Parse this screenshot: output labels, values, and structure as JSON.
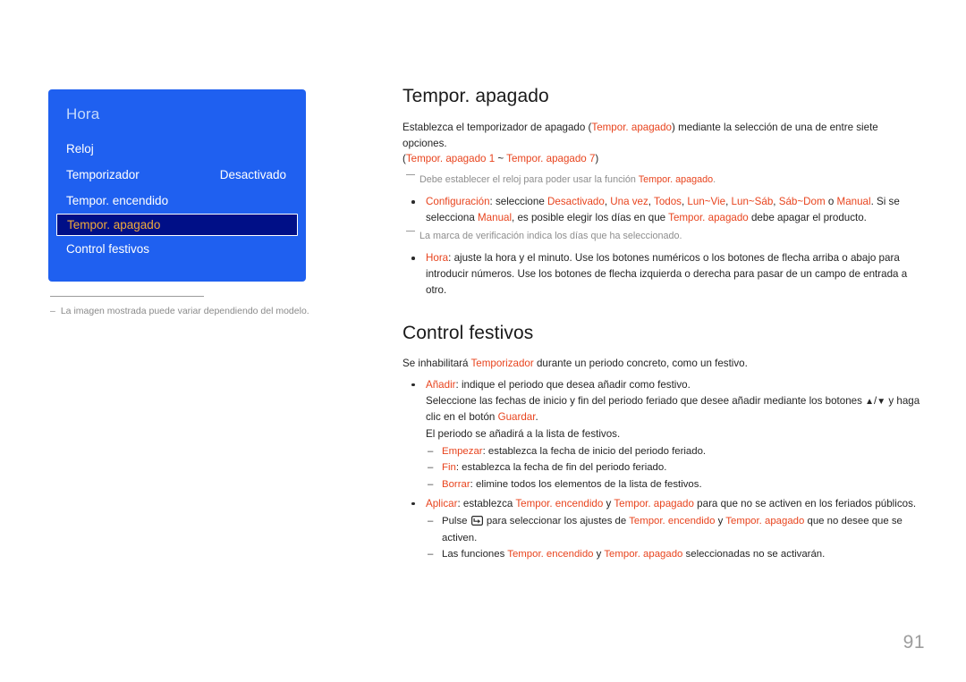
{
  "osd": {
    "title": "Hora",
    "rows": [
      {
        "label": "Reloj",
        "value": "",
        "selected": false
      },
      {
        "label": "Temporizador",
        "value": "Desactivado",
        "selected": false
      },
      {
        "label": "Tempor. encendido",
        "value": "",
        "selected": false
      },
      {
        "label": "Tempor. apagado",
        "value": "",
        "selected": true
      },
      {
        "label": "Control festivos",
        "value": "",
        "selected": false
      }
    ],
    "caption_dash": "–",
    "caption": "La imagen mostrada puede variar dependiendo del modelo."
  },
  "doc": {
    "heading1": "Tempor. apagado",
    "intro_1": "Establezca el temporizador de apagado (",
    "intro_accent_1": "Tempor. apagado",
    "intro_2": ") mediante la selección de una de entre siete opciones.",
    "intro_3": "(",
    "intro_accent_2": "Tempor. apagado 1",
    "intro_4": " ~ ",
    "intro_accent_3": "Tempor. apagado 7",
    "intro_5": ")",
    "note1_mark": "⎺",
    "note1_a": "Debe establecer el reloj para poder usar la función ",
    "note1_accent": "Tempor. apagado",
    "note1_b": ".",
    "b1_accent": "Configuración",
    "b1_t1": ": seleccione ",
    "b1_o1": "Desactivado",
    "b1_t2": ", ",
    "b1_o2": "Una vez",
    "b1_t3": ", ",
    "b1_o3": "Todos",
    "b1_t4": ", ",
    "b1_o4": "Lun~Vie",
    "b1_t5": ", ",
    "b1_o5": "Lun~Sáb",
    "b1_t6": ", ",
    "b1_o6": "Sáb~Dom",
    "b1_t7": " o ",
    "b1_o7": "Manual",
    "b1_t8": ". Si se selecciona ",
    "b1_o8": "Manual",
    "b1_t9": ", es posible elegir los días en que ",
    "b1_o9": "Tempor. apagado",
    "b1_t10": " debe apagar el producto.",
    "note2_mark": "⎺",
    "note2": "La marca de verificación indica los días que ha seleccionado.",
    "b2_accent": "Hora",
    "b2_text": ": ajuste la hora y el minuto. Use los botones numéricos o los botones de flecha arriba o abajo para introducir números. Use los botones de flecha izquierda o derecha para pasar de un campo de entrada a otro.",
    "heading2": "Control festivos",
    "intro2_1": "Se inhabilitará ",
    "intro2_accent": "Temporizador",
    "intro2_2": " durante un periodo concreto, como un festivo.",
    "b3_accent": "Añadir",
    "b3_text": ": indique el periodo que desea añadir como festivo.",
    "b3_sub1_a": "Seleccione las fechas de inicio y fin del periodo feriado que desee añadir mediante los botones ",
    "b3_sub1_up": "▲",
    "b3_sub1_slash": "/",
    "b3_sub1_down": "▼",
    "b3_sub1_b": " y haga clic en el botón ",
    "b3_sub1_accent": "Guardar",
    "b3_sub1_c": ".",
    "b3_sub2": "El periodo se añadirá a la lista de festivos.",
    "b3_i1_accent": "Empezar",
    "b3_i1_text": ": establezca la fecha de inicio del periodo feriado.",
    "b3_i2_accent": "Fin",
    "b3_i2_text": ": establezca la fecha de fin del periodo feriado.",
    "b3_i3_accent": "Borrar",
    "b3_i3_text": ": elimine todos los elementos de la lista de festivos.",
    "b4_accent": "Aplicar",
    "b4_t1": ": establezca ",
    "b4_o1": "Tempor. encendido",
    "b4_t2": " y ",
    "b4_o2": "Tempor. apagado",
    "b4_t3": " para que no se activen en los feriados públicos.",
    "b4_i1_a": "Pulse ",
    "b4_i1_icon": "enter-key-icon",
    "b4_i1_b": " para seleccionar los ajustes de ",
    "b4_i1_o1": "Tempor. encendido",
    "b4_i1_c": " y ",
    "b4_i1_o2": "Tempor. apagado",
    "b4_i1_d": " que no desee que se activen.",
    "b4_i2_a": "Las funciones ",
    "b4_i2_o1": "Tempor. encendido",
    "b4_i2_b": " y ",
    "b4_i2_o2": "Tempor. apagado",
    "b4_i2_c": " seleccionadas no se activarán."
  },
  "footer": {
    "page_number": "91"
  },
  "colors": {
    "accent": "#e8441e",
    "osd_blue": "#1f60f0",
    "osd_selected_bg": "#000f87",
    "osd_selected_text": "#f0a93c",
    "osd_title": "#c3d8fb",
    "note_gray": "#8e8e8e",
    "page_number_gray": "#9d9d9d"
  }
}
